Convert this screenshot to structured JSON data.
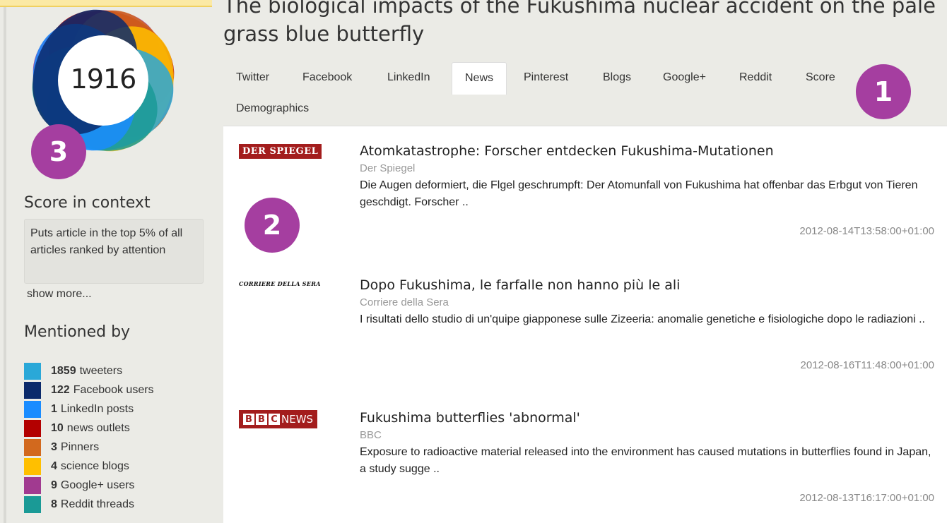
{
  "article": {
    "title": "The biological impacts of the Fukushima nuclear accident on the pale grass blue butterfly"
  },
  "score": {
    "value": "1916",
    "donut_colors": [
      "#2aa8d8",
      "#0b2a6b",
      "#1a8cff",
      "#b30000",
      "#d2691e",
      "#ffbf00",
      "#a13a90",
      "#1a9a96"
    ]
  },
  "badges": [
    "1",
    "2",
    "3"
  ],
  "sidebar": {
    "score_context_title": "Score in context",
    "score_context_text": "Puts article in the top 5% of all articles ranked by attention",
    "show_more": "show more...",
    "mentioned_title": "Mentioned by",
    "mentions": [
      {
        "count": "1859",
        "label": "tweeters",
        "color": "#2aa8d8"
      },
      {
        "count": "122",
        "label": "Facebook users",
        "color": "#0b2a6b"
      },
      {
        "count": "1",
        "label": "LinkedIn posts",
        "color": "#1a8cff"
      },
      {
        "count": "10",
        "label": "news outlets",
        "color": "#b30000"
      },
      {
        "count": "3",
        "label": "Pinners",
        "color": "#d2691e"
      },
      {
        "count": "4",
        "label": "science blogs",
        "color": "#ffbf00"
      },
      {
        "count": "9",
        "label": "Google+ users",
        "color": "#a13a90"
      },
      {
        "count": "8",
        "label": "Reddit threads",
        "color": "#1a9a96"
      }
    ]
  },
  "tabs": [
    "Twitter",
    "Facebook",
    "LinkedIn",
    "News",
    "Pinterest",
    "Blogs",
    "Google+",
    "Reddit",
    "Score",
    "Demographics"
  ],
  "active_tab": "News",
  "news": [
    {
      "logo": "DER SPIEGEL",
      "title": "Atomkatastrophe: Forscher entdecken Fukushima-Mutationen",
      "source": "Der Spiegel",
      "snippet": "Die Augen deformiert, die Flgel geschrumpft: Der Atomunfall von Fukushima hat offenbar das Erbgut von Tieren geschdigt. Forscher ..",
      "date": "2012-08-14T13:58:00+01:00"
    },
    {
      "logo": "CORRIERE DELLA SERA",
      "title": "Dopo Fukushima, le farfalle non hanno più le ali",
      "source": "Corriere della Sera",
      "snippet": "I risultati dello studio di un'quipe giapponese sulle Zizeeria: anomalie genetiche e fisiologiche dopo le radiazioni ..",
      "date": "2012-08-16T11:48:00+01:00"
    },
    {
      "logo_box": "BBC",
      "logo": "NEWS",
      "title": "Fukushima butterflies 'abnormal'",
      "source": "BBC",
      "snippet": "Exposure to radioactive material released into the environment has caused mutations in butterflies found in Japan, a study sugge ..",
      "date": "2012-08-13T16:17:00+01:00"
    }
  ]
}
